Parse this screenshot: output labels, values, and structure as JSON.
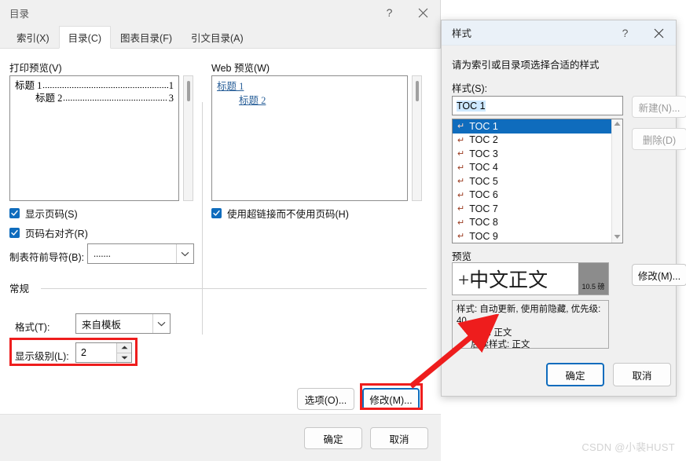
{
  "toc_dialog": {
    "title": "目录",
    "help_icon": "?",
    "close_icon": "close-icon",
    "tabs": [
      {
        "label": "索引(X)",
        "active": false
      },
      {
        "label": "目录(C)",
        "active": true
      },
      {
        "label": "图表目录(F)",
        "active": false
      },
      {
        "label": "引文目录(A)",
        "active": false
      }
    ],
    "print_preview": {
      "label": "打印预览(V)",
      "lines": [
        {
          "text": "标题 1",
          "page": "1",
          "indent": false
        },
        {
          "text": "标题 2",
          "page": "3",
          "indent": true
        }
      ]
    },
    "web_preview": {
      "label": "Web 预览(W)",
      "lines": [
        {
          "text": "标题 1",
          "indent": false
        },
        {
          "text": "标题 2",
          "indent": true
        }
      ]
    },
    "checkboxes": [
      {
        "label": "显示页码(S)",
        "checked": true
      },
      {
        "label": "页码右对齐(R)",
        "checked": true
      },
      {
        "label": "使用超链接而不使用页码(H)",
        "checked": true
      }
    ],
    "tab_leader": {
      "label": "制表符前导符(B):",
      "value": "......."
    },
    "general": {
      "title": "常规",
      "format": {
        "label": "格式(T):",
        "value": "来自模板"
      },
      "show_levels": {
        "label": "显示级别(L):",
        "value": "2"
      }
    },
    "buttons": {
      "options": "选项(O)...",
      "modify": "修改(M)...",
      "ok": "确定",
      "cancel": "取消"
    }
  },
  "style_dialog": {
    "title": "样式",
    "help_icon": "?",
    "close_icon": "close-icon",
    "prompt": "请为索引或目录项选择合适的样式",
    "style_field": {
      "label": "样式(S):",
      "value": "TOC 1"
    },
    "style_list": [
      {
        "label": "TOC 1",
        "selected": true
      },
      {
        "label": "TOC 2",
        "selected": false
      },
      {
        "label": "TOC 3",
        "selected": false
      },
      {
        "label": "TOC 4",
        "selected": false
      },
      {
        "label": "TOC 5",
        "selected": false
      },
      {
        "label": "TOC 6",
        "selected": false
      },
      {
        "label": "TOC 7",
        "selected": false
      },
      {
        "label": "TOC 8",
        "selected": false
      },
      {
        "label": "TOC 9",
        "selected": false
      }
    ],
    "side_buttons": {
      "new": "新建(N)...",
      "delete": "删除(D)"
    },
    "preview": {
      "label": "预览",
      "sample_text": "+中文正文",
      "size_badge": "10.5 磅",
      "description_lines": [
        "样式: 自动更新, 使用前隐藏, 优先级: 40",
        "基于: 正文",
        "后续样式: 正文"
      ]
    },
    "buttons": {
      "modify": "修改(M)...",
      "ok": "确定",
      "cancel": "取消"
    }
  },
  "annotations": {
    "highlight_color": "#ee1d1d",
    "arrow_color": "#ee1d1d"
  },
  "watermark": "CSDN @小裴HUST"
}
